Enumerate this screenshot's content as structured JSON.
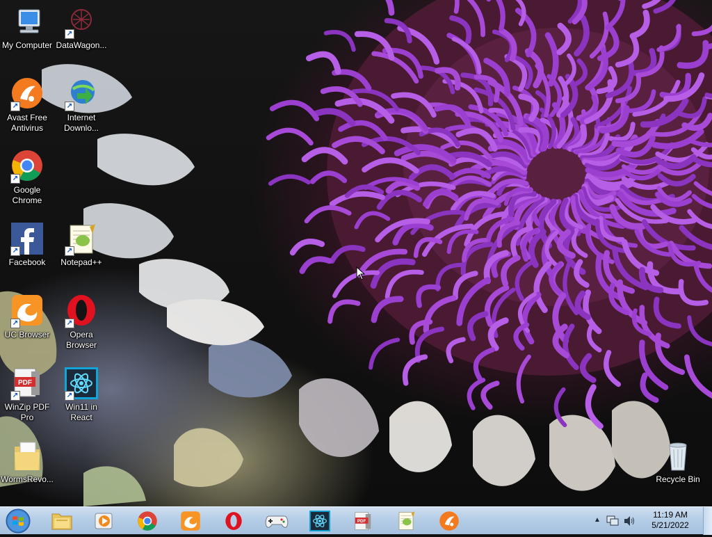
{
  "desktop": {
    "icons": [
      {
        "label": "My Computer",
        "icon": "computer-icon"
      },
      {
        "label": "DataWagon...",
        "icon": "datawagon-icon"
      },
      {
        "label": "Avast Free\nAntivirus",
        "icon": "avast-icon"
      },
      {
        "label": "Internet\nDownlo...",
        "icon": "internet-download-manager-icon"
      },
      {
        "label": "Google\nChrome",
        "icon": "chrome-icon"
      },
      {
        "label": "Facebook",
        "icon": "facebook-icon"
      },
      {
        "label": "Notepad++",
        "icon": "notepad-plus-plus-icon"
      },
      {
        "label": "UC Browser",
        "icon": "uc-browser-icon"
      },
      {
        "label": "Opera\nBrowser",
        "icon": "opera-icon"
      },
      {
        "label": "WinZip PDF\nPro",
        "icon": "winzip-pdf-icon"
      },
      {
        "label": "Win11 in\nReact",
        "icon": "react-icon"
      },
      {
        "label": "WormsRevo...",
        "icon": "folder-icon"
      },
      {
        "label": "Recycle Bin",
        "icon": "recycle-bin-icon"
      }
    ]
  },
  "taskbar": {
    "pinned": [
      "file-explorer-icon",
      "media-player-icon",
      "chrome-icon",
      "uc-browser-icon",
      "opera-icon",
      "game-controller-icon",
      "react-icon",
      "pdf-icon",
      "notepad-plus-plus-icon",
      "avast-icon"
    ],
    "clock": {
      "time": "11:19 AM",
      "date": "5/21/2022"
    }
  },
  "colors": {
    "taskbar": "#b5cde6",
    "petal": "#9b3fd0",
    "petal_light": "#b65ee6"
  }
}
